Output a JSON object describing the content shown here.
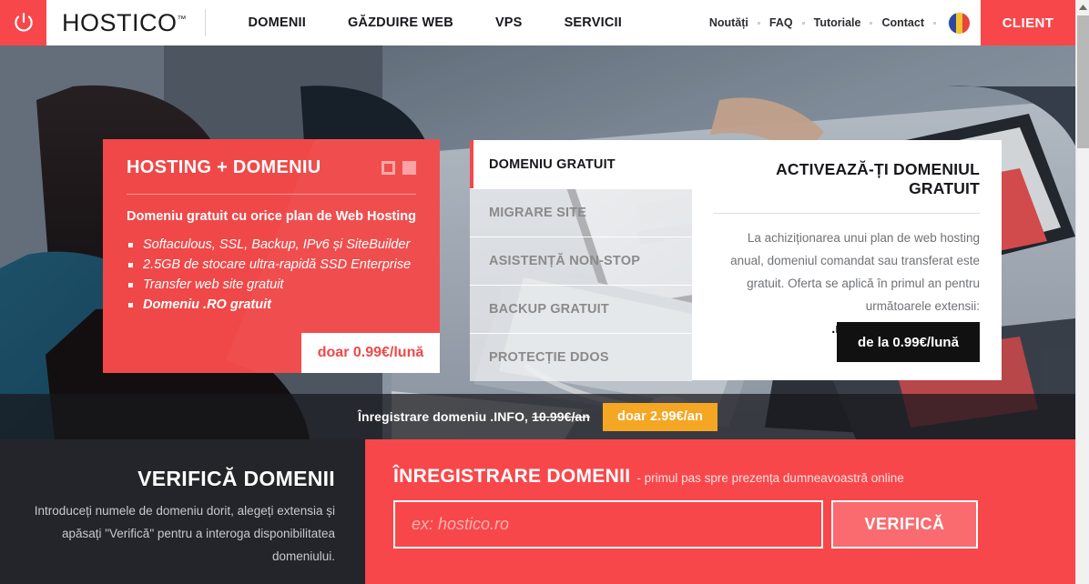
{
  "header": {
    "logo_icon": "power-icon",
    "brand": "HOSTICO",
    "brand_tm": "™",
    "main_nav": [
      {
        "label": "DOMENII"
      },
      {
        "label": "GĂZDUIRE WEB"
      },
      {
        "label": "VPS"
      },
      {
        "label": "SERVICII"
      }
    ],
    "top_links": [
      {
        "label": "Noutăți"
      },
      {
        "label": "FAQ"
      },
      {
        "label": "Tutoriale"
      },
      {
        "label": "Contact"
      }
    ],
    "flag_icon": "romania-flag-icon",
    "client_button": "CLIENT"
  },
  "hero": {
    "offer_card": {
      "title": "HOSTING + DOMENIU",
      "subtitle": "Domeniu gratuit cu orice plan de Web Hosting",
      "features": [
        "Softaculous, SSL, Backup, IPv6 și SiteBuilder",
        "2.5GB de stocare ultra-rapidă SSD Enterprise",
        "Transfer web site gratuit",
        "Domeniu .RO gratuit"
      ],
      "price_button": "doar 0.99€/lună",
      "slider_dots": 2
    },
    "tabs": [
      {
        "label": "DOMENIU GRATUIT",
        "active": true
      },
      {
        "label": "MIGRARE SITE",
        "active": false
      },
      {
        "label": "ASISTENȚĂ NON-STOP",
        "active": false
      },
      {
        "label": "BACKUP GRATUIT",
        "active": false
      },
      {
        "label": "PROTECȚIE DDOS",
        "active": false
      }
    ],
    "pane": {
      "title": "ACTIVEAZĂ-ȚI DOMENIUL GRATUIT",
      "body": "La achiziționarea unui plan de web hosting anual, domeniul comandat sau transferat este gratuit. Oferta se aplică în primul an pentru următoarele extensii:",
      "extensions": ".ro, .eu, .com, .net, .org.",
      "button": "de la 0.99€/lună"
    },
    "promo_strip": {
      "text_before": "Înregistrare domeniu .INFO,",
      "old_price": "10.99€/an",
      "button": "doar 2.99€/an"
    }
  },
  "bottom": {
    "check": {
      "title": "VERIFICĂ DOMENII",
      "description": "Introduceți numele de domeniu dorit, alegeți extensia și apăsați \"Verifică\" pentru a interoga disponibilitatea domeniului."
    },
    "register": {
      "title": "ÎNREGISTRARE DOMENII",
      "subtitle": "- primul pas spre prezența dumneavoastră online",
      "input_value": "",
      "input_placeholder": "ex: hostico.ro",
      "verify_button": "VERIFICĂ"
    }
  },
  "colors": {
    "brand_red": "#F8474A",
    "card_red": "#F04848",
    "promo_orange": "#F5A623",
    "dark": "#24242B",
    "black_button": "#111111"
  }
}
